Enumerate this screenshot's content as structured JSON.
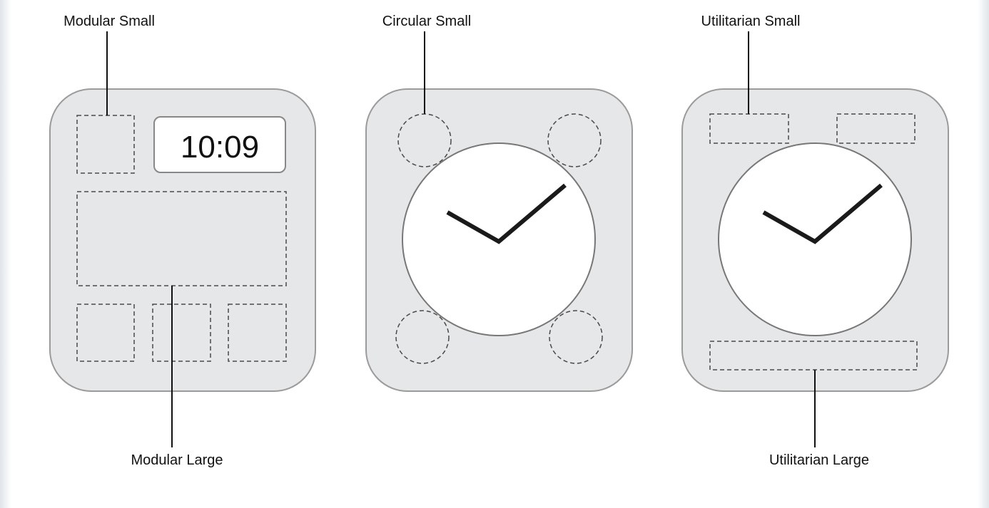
{
  "labels": {
    "modular_small": "Modular Small",
    "modular_large": "Modular Large",
    "circular_small": "Circular Small",
    "utilitarian_small": "Utilitarian Small",
    "utilitarian_large": "Utilitarian Large"
  },
  "modular_time": "10:09"
}
